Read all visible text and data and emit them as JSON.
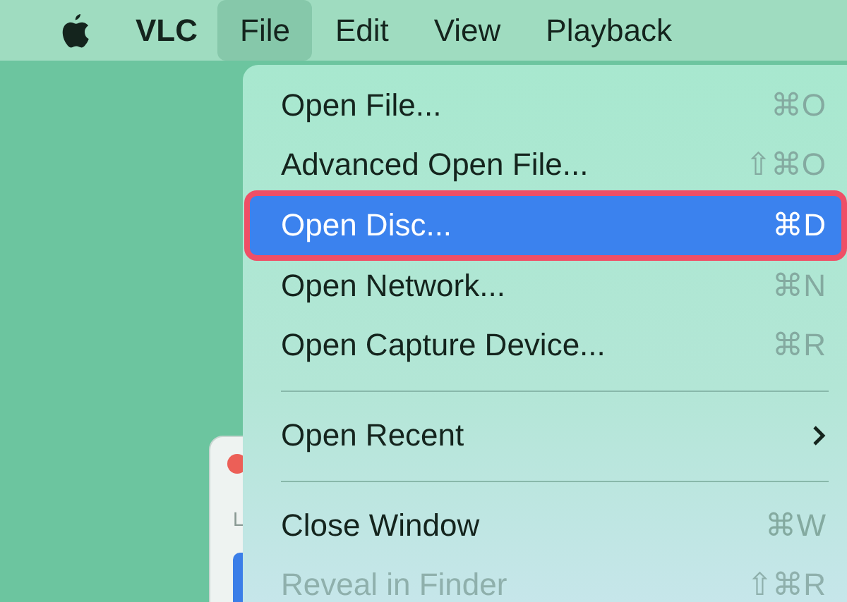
{
  "menu_bar": {
    "app_name": "VLC",
    "menus": [
      {
        "label": "File",
        "selected": true
      },
      {
        "label": "Edit",
        "selected": false
      },
      {
        "label": "View",
        "selected": false
      },
      {
        "label": "Playback",
        "selected": false
      }
    ]
  },
  "background_window": {
    "label": "L"
  },
  "file_menu": {
    "items": [
      {
        "kind": "item",
        "label": "Open File...",
        "shortcut": "⌘O",
        "selected": false,
        "disabled": false,
        "outlined": false
      },
      {
        "kind": "item",
        "label": "Advanced Open File...",
        "shortcut": "⇧⌘O",
        "selected": false,
        "disabled": false,
        "outlined": false
      },
      {
        "kind": "item",
        "label": "Open Disc...",
        "shortcut": "⌘D",
        "selected": true,
        "disabled": false,
        "outlined": true
      },
      {
        "kind": "item",
        "label": "Open Network...",
        "shortcut": "⌘N",
        "selected": false,
        "disabled": false,
        "outlined": false
      },
      {
        "kind": "item",
        "label": "Open Capture Device...",
        "shortcut": "⌘R",
        "selected": false,
        "disabled": false,
        "outlined": false
      },
      {
        "kind": "separator"
      },
      {
        "kind": "submenu",
        "label": "Open Recent",
        "selected": false,
        "disabled": false,
        "outlined": false
      },
      {
        "kind": "separator"
      },
      {
        "kind": "item",
        "label": "Close Window",
        "shortcut": "⌘W",
        "selected": false,
        "disabled": false,
        "outlined": false
      },
      {
        "kind": "item",
        "label": "Reveal in Finder",
        "shortcut": "⇧⌘R",
        "selected": false,
        "disabled": true,
        "outlined": false
      }
    ]
  }
}
